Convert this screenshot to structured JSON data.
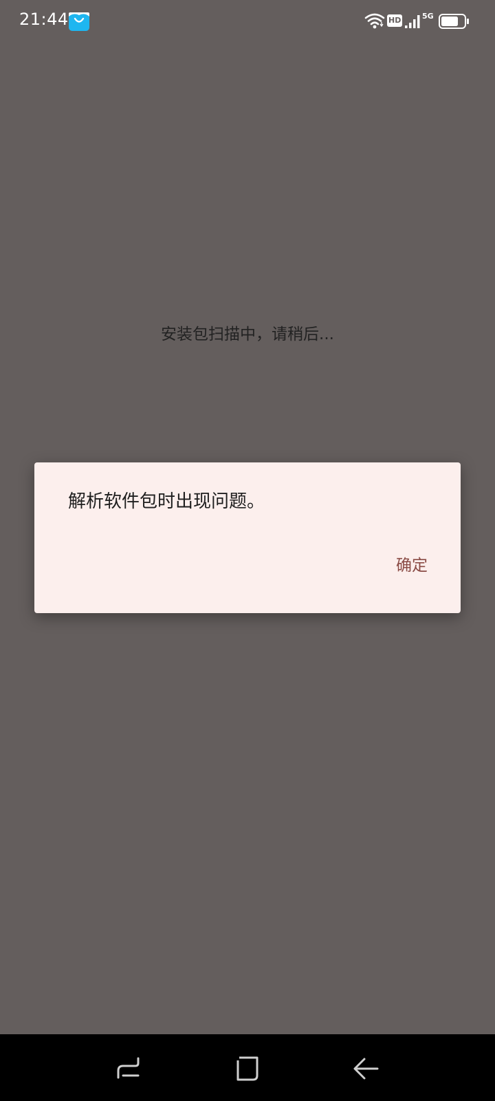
{
  "status_bar": {
    "time": "21:44",
    "app_icon": "shopping-bag-icon",
    "indicators": [
      "wifi-icon",
      "hd-icon",
      "signal-5g-icon",
      "battery-icon"
    ],
    "hd_label": "HD",
    "network_label": "5G",
    "battery_level": 0.75
  },
  "main": {
    "scan_message": "安装包扫描中，请稍后..."
  },
  "dialog": {
    "message": "解析软件包时出现问题。",
    "confirm_label": "确定"
  },
  "nav_bar": {
    "buttons": [
      "recent-apps-icon",
      "home-icon",
      "back-icon"
    ]
  },
  "colors": {
    "background": "#645e5d",
    "dialog_background": "#fcefed",
    "confirm_text": "#8a4b45",
    "nav_bar": "#000000"
  }
}
